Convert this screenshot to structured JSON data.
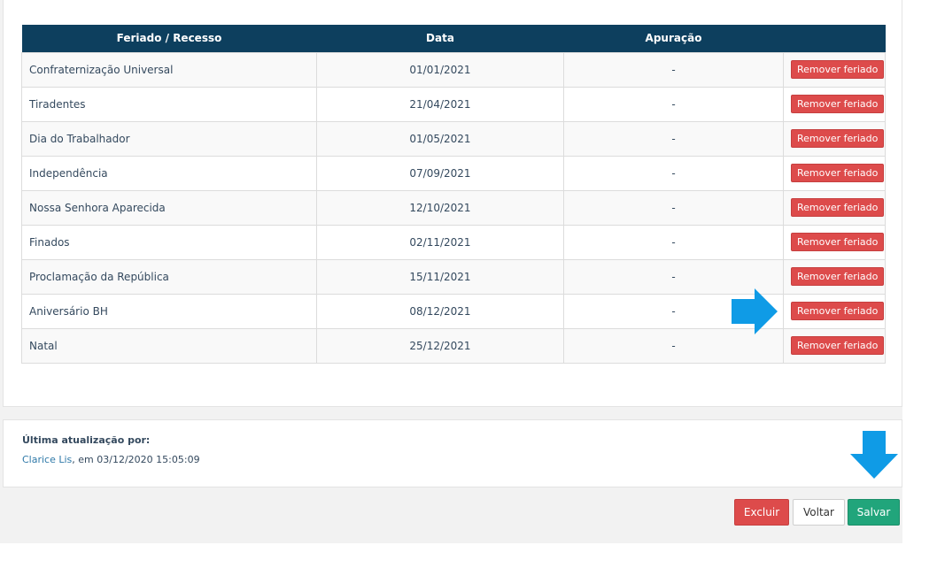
{
  "table": {
    "headers": [
      "Feriado / Recesso",
      "Data",
      "Apuração",
      ""
    ],
    "rows": [
      {
        "name": "Confraternização Universal",
        "date": "01/01/2021",
        "apuracao": "-",
        "action": "Remover feriado"
      },
      {
        "name": "Tiradentes",
        "date": "21/04/2021",
        "apuracao": "-",
        "action": "Remover feriado"
      },
      {
        "name": "Dia do Trabalhador",
        "date": "01/05/2021",
        "apuracao": "-",
        "action": "Remover feriado"
      },
      {
        "name": "Independência",
        "date": "07/09/2021",
        "apuracao": "-",
        "action": "Remover feriado"
      },
      {
        "name": "Nossa Senhora Aparecida",
        "date": "12/10/2021",
        "apuracao": "-",
        "action": "Remover feriado"
      },
      {
        "name": "Finados",
        "date": "02/11/2021",
        "apuracao": "-",
        "action": "Remover feriado"
      },
      {
        "name": "Proclamação da República",
        "date": "15/11/2021",
        "apuracao": "-",
        "action": "Remover feriado"
      },
      {
        "name": "Aniversário BH",
        "date": "08/12/2021",
        "apuracao": "-",
        "action": "Remover feriado"
      },
      {
        "name": "Natal",
        "date": "25/12/2021",
        "apuracao": "-",
        "action": "Remover feriado"
      }
    ]
  },
  "update": {
    "title": "Última atualização por:",
    "user": "Clarice Lis",
    "suffix": ", em 03/12/2020 15:05:09"
  },
  "actions": {
    "excluir": "Excluir",
    "voltar": "Voltar",
    "salvar": "Salvar"
  },
  "colors": {
    "header_bg": "#0d3f5e",
    "danger": "#dd4b4b",
    "success": "#21a57b",
    "arrow": "#0f9be6"
  },
  "icons": {
    "arrow_right": "arrow-right-icon",
    "arrow_down": "arrow-down-icon"
  }
}
